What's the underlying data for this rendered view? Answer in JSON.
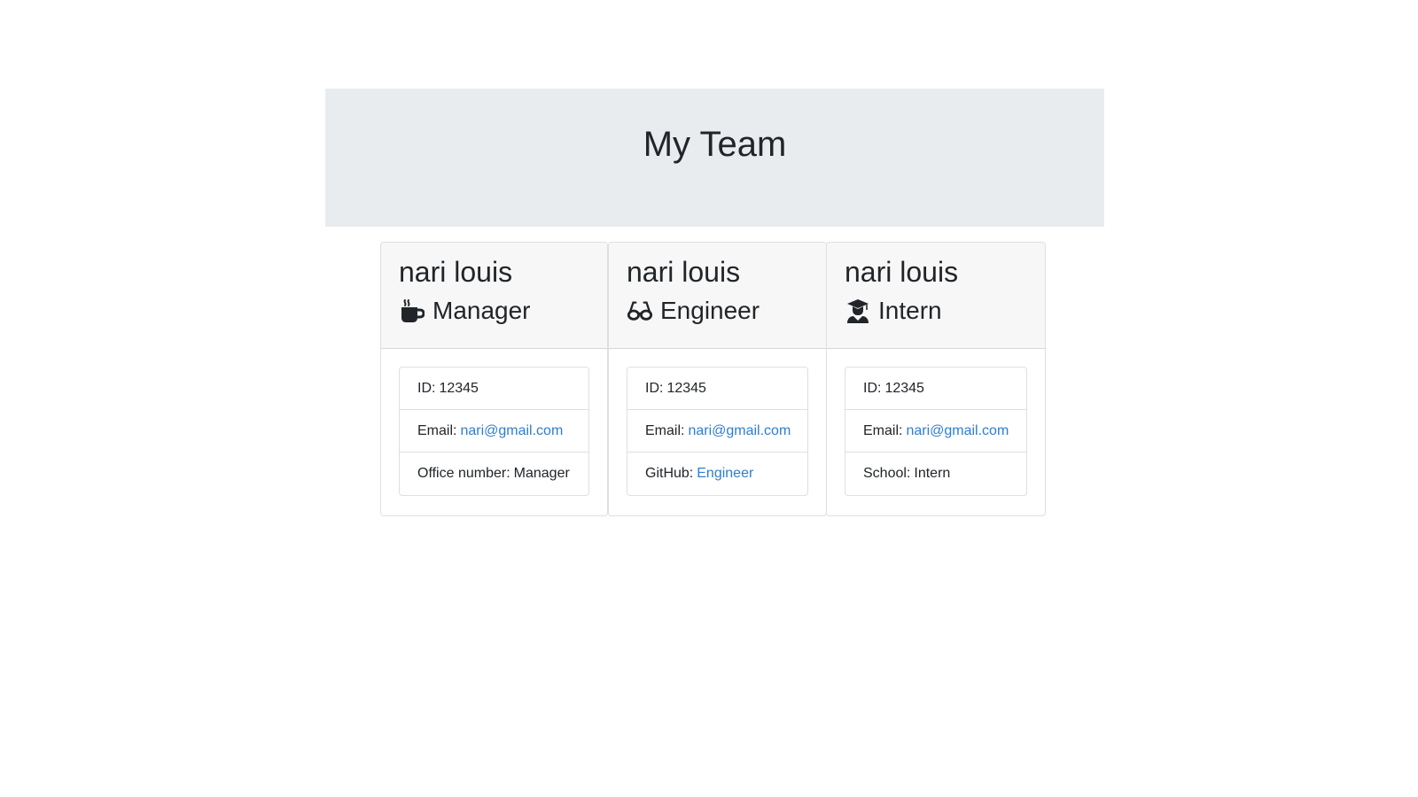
{
  "header": {
    "title": "My Team"
  },
  "cards": [
    {
      "name": "nari louis",
      "role": "Manager",
      "icon": "coffee-mug-icon",
      "id_label": "ID:",
      "id_value": "12345",
      "email_label": "Email:",
      "email_value": "nari@gmail.com",
      "extra_label": "Office number:",
      "extra_value": "Manager"
    },
    {
      "name": "nari louis",
      "role": "Engineer",
      "icon": "glasses-icon",
      "id_label": "ID:",
      "id_value": "12345",
      "email_label": "Email:",
      "email_value": "nari@gmail.com",
      "extra_label": "GitHub:",
      "extra_value": "Engineer"
    },
    {
      "name": "nari louis",
      "role": "Intern",
      "icon": "graduate-icon",
      "id_label": "ID:",
      "id_value": "12345",
      "email_label": "Email:",
      "email_value": "nari@gmail.com",
      "extra_label": "School:",
      "extra_value": "Intern"
    }
  ],
  "colors": {
    "header_bg": "#e9ecef",
    "card_header_bg": "#f7f7f7",
    "link": "#2f7dd1",
    "text": "#212529"
  }
}
